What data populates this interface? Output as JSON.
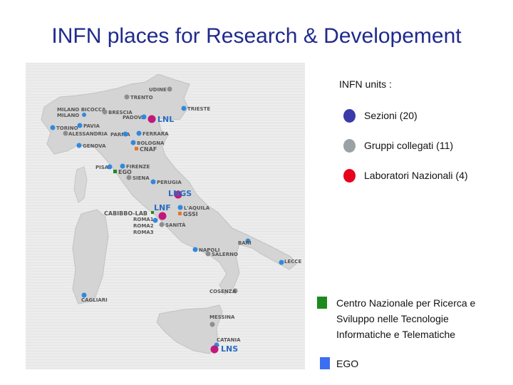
{
  "title": "INFN places for Research & Developement",
  "legend": {
    "heading": "INFN units :",
    "items": [
      {
        "label": "Sezioni (20)",
        "color": "#3a3aa8"
      },
      {
        "label": "Gruppi collegati (11)",
        "color": "#9aa2a6"
      },
      {
        "label": "Laboratori Nazionali (4)",
        "color": "#e8001c"
      }
    ],
    "cnaf": {
      "lines": [
        "Centro Nazionale per Ricerca e",
        "Sviluppo nelle Tecnologie",
        "Informatiche e Telematiche"
      ],
      "color": "#1d8a1d"
    },
    "ego": {
      "label": "EGO",
      "color": "#3b6ef0"
    }
  },
  "map": {
    "cities": {
      "udine": "UDINE",
      "trento": "TRENTO",
      "trieste": "TRIESTE",
      "milano_bicocca": "MILANO BICOCCA",
      "milano": "MILANO",
      "brescia": "BRESCIA",
      "padova": "PADOVA",
      "lnl": "LNL",
      "torino": "TORINO",
      "pavia": "PAVIA",
      "alessandria": "ALESSANDRIA",
      "parma": "PARMA",
      "ferrara": "FERRARA",
      "genova": "GENOVA",
      "bologna": "BOLOGNA",
      "cnaf": "CNAF",
      "firenze": "FIRENZE",
      "pisa": "PISA",
      "ego": "EGO",
      "siena": "SIENA",
      "perugia": "PERUGIA",
      "lngs": "LNGS",
      "laquila": "L'AQUILA",
      "gssi": "GSSI",
      "cabibbo": "CABIBBO-LAB",
      "lnf": "LNF",
      "roma1": "ROMA1",
      "roma2": "ROMA2",
      "roma3": "ROMA3",
      "sanita": "SANITÀ",
      "bari": "BARI",
      "napoli": "NAPOLI",
      "salerno": "SALERNO",
      "lecce": "LECCE",
      "cosenza": "COSENZA",
      "cagliari": "CAGLIARI",
      "messina": "MESSINA",
      "catania": "CATANIA",
      "lns": "LNS"
    }
  }
}
